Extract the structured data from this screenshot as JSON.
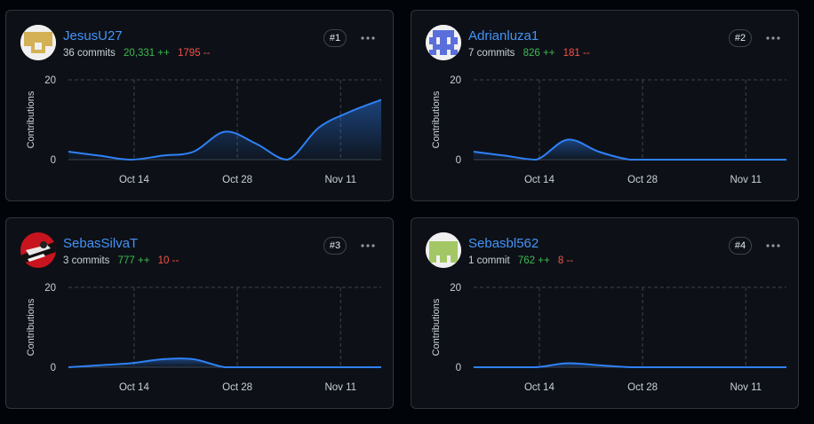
{
  "contributors": [
    {
      "username": "JesusU27",
      "commits": "36 commits",
      "additions": "20,331 ++",
      "deletions": "1795 --",
      "rank": "#1",
      "avatar_color": "#d4b154",
      "avatar_icon": "identicon-icon"
    },
    {
      "username": "Adrianluza1",
      "commits": "7 commits",
      "additions": "826 ++",
      "deletions": "181 --",
      "rank": "#2",
      "avatar_color": "#5a6fdb",
      "avatar_icon": "identicon-icon"
    },
    {
      "username": "SebasSilvaT",
      "commits": "3 commits",
      "additions": "777 ++",
      "deletions": "10 --",
      "rank": "#3",
      "avatar_color": "#c8141e",
      "avatar_icon": "profile-photo"
    },
    {
      "username": "Sebasbl562",
      "commits": "1 commit",
      "additions": "762 ++",
      "deletions": "8 --",
      "rank": "#4",
      "avatar_color": "#a4c765",
      "avatar_icon": "identicon-icon"
    }
  ],
  "colors": {
    "accent": "#4493f8",
    "additions": "#3fb950",
    "deletions": "#f85149",
    "line": "#2f81f7"
  },
  "chart_data": [
    {
      "type": "area",
      "ylabel": "Contributions",
      "ylim": [
        0,
        20
      ],
      "yticks": [
        "0",
        "20"
      ],
      "xticks": [
        "Oct 14",
        "Oct 28",
        "Nov 11"
      ],
      "x": [
        0,
        1,
        2,
        3,
        4,
        5,
        6,
        7,
        8,
        9,
        10
      ],
      "values": [
        2,
        1,
        0,
        1,
        2,
        7,
        4,
        0,
        8,
        12,
        15
      ]
    },
    {
      "type": "area",
      "ylabel": "Contributions",
      "ylim": [
        0,
        20
      ],
      "yticks": [
        "0",
        "20"
      ],
      "xticks": [
        "Oct 14",
        "Oct 28",
        "Nov 11"
      ],
      "x": [
        0,
        1,
        2,
        3,
        4,
        5,
        6,
        7,
        8,
        9,
        10
      ],
      "values": [
        2,
        1,
        0,
        5,
        2,
        0,
        0,
        0,
        0,
        0,
        0
      ]
    },
    {
      "type": "area",
      "ylabel": "Contributions",
      "ylim": [
        0,
        20
      ],
      "yticks": [
        "0",
        "20"
      ],
      "xticks": [
        "Oct 14",
        "Oct 28",
        "Nov 11"
      ],
      "x": [
        0,
        1,
        2,
        3,
        4,
        5,
        6,
        7,
        8,
        9,
        10
      ],
      "values": [
        0,
        0.5,
        1,
        2,
        2,
        0,
        0,
        0,
        0,
        0,
        0
      ]
    },
    {
      "type": "area",
      "ylabel": "Contributions",
      "ylim": [
        0,
        20
      ],
      "yticks": [
        "0",
        "20"
      ],
      "xticks": [
        "Oct 14",
        "Oct 28",
        "Nov 11"
      ],
      "x": [
        0,
        1,
        2,
        3,
        4,
        5,
        6,
        7,
        8,
        9,
        10
      ],
      "values": [
        0,
        0,
        0,
        1,
        0.5,
        0,
        0,
        0,
        0,
        0,
        0
      ]
    }
  ]
}
